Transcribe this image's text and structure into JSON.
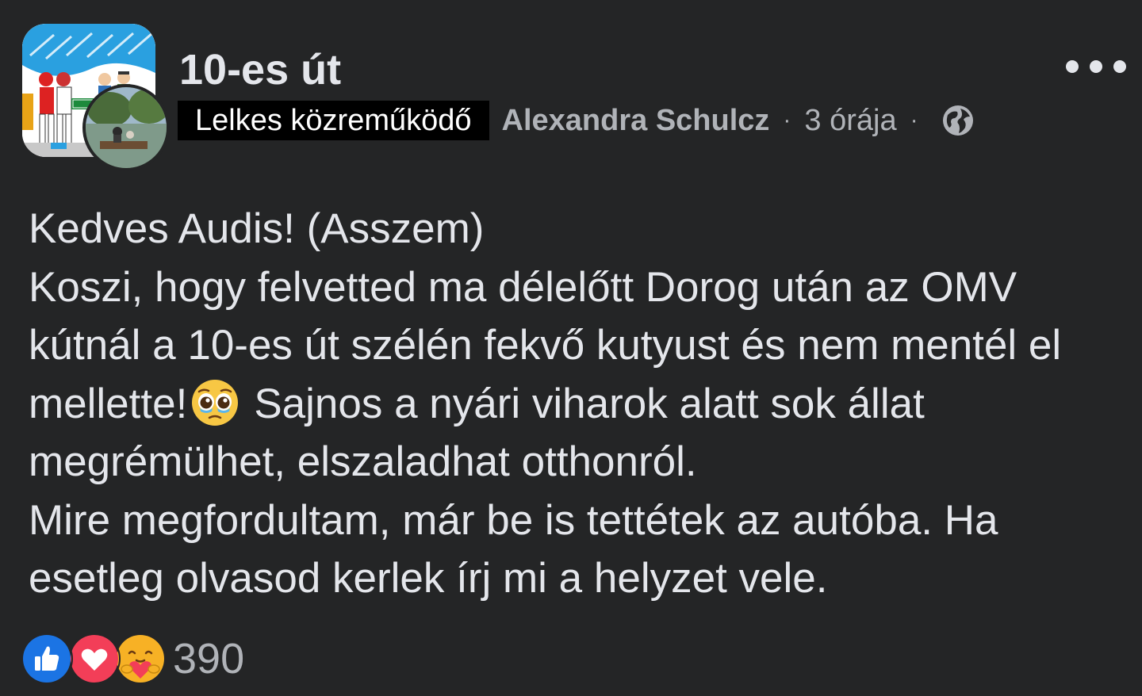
{
  "post": {
    "group_name": "10-es út",
    "badge": "Lelkes közreműködő",
    "author": "Alexandra Schulcz",
    "separator": "·",
    "time": "3 órája",
    "privacy_icon": "globe-icon",
    "more_icon": "more-options-icon",
    "body_lines": [
      "Kedves Audis! (Asszem)",
      "Koszi, hogy felvetted ma délelőtt Dorog után az OMV",
      "kútnál a 10-es út szélén fekvő kutyust és nem mentél el",
      "mellette!",
      "Sajnos a nyári viharok alatt sok állat",
      "megrémülhet, elszaladhat otthonról.",
      "Mire megfordultam, már be is tettétek az autóba. Ha",
      "esetleg olvasod kerlek írj mi a helyzet vele."
    ],
    "inline_emoji": "pleading-face-emoji",
    "reactions": {
      "icons": [
        "like-icon",
        "love-icon",
        "care-icon"
      ],
      "count": "390"
    }
  },
  "colors": {
    "background": "#242526",
    "primary_text": "#e4e6eb",
    "secondary_text": "#b0b3b8",
    "like_blue": "#1b74e4",
    "love_red": "#f33e58",
    "care_yellow": "#f7b125"
  }
}
